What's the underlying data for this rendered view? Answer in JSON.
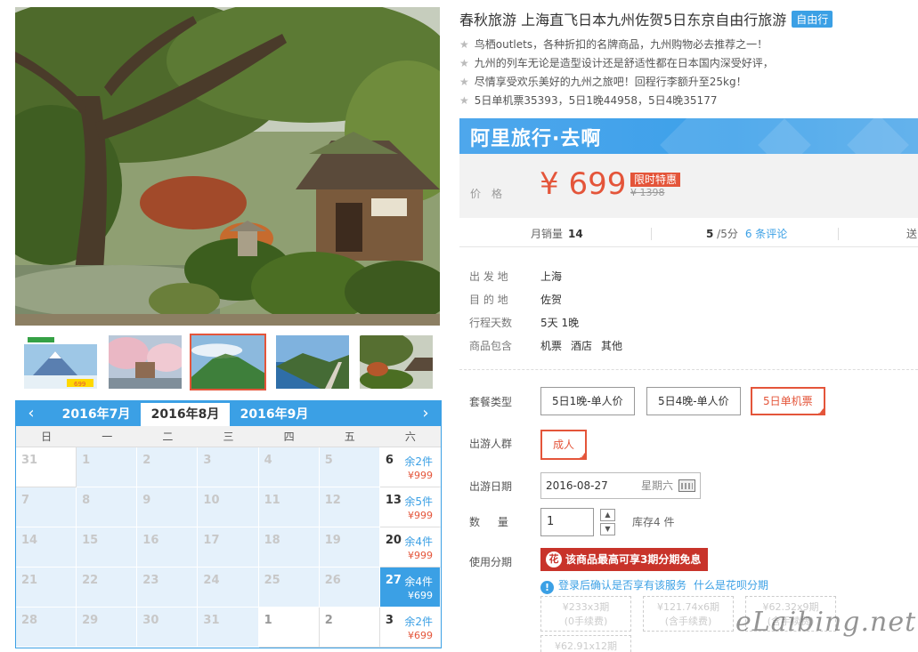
{
  "product": {
    "title": "春秋旅游 上海直飞日本九州佐贺5日东京自由行旅游",
    "tag": "自由行",
    "features": [
      "鸟栖outlets，各种折扣的名牌商品，九州购物必去推荐之一！",
      "九州的列车无论是造型设计还是舒适性都在日本国内深受好评，",
      "尽情享受欢乐美好的九州之旅吧！回程行李额升至25kg！",
      "5日单机票35393，5日1晚44958，5日4晚35177"
    ]
  },
  "price": {
    "brand": "阿里旅行·去啊",
    "label": "价格",
    "value": "¥ 699",
    "tag": "限时特惠",
    "original": "¥ 1398"
  },
  "stats": {
    "sales_label": "月销量",
    "sales_value": "14",
    "rating_value": "5",
    "rating_suffix": " /5分",
    "reviews": "6 条评论",
    "more": "送"
  },
  "info": [
    {
      "key": "出 发 地",
      "value": "上海"
    },
    {
      "key": "目 的 地",
      "value": "佐贺"
    },
    {
      "key": "行程天数",
      "value": "5天 1晚"
    },
    {
      "key": "商品包含",
      "items": [
        "机票",
        "酒店",
        "其他"
      ]
    }
  ],
  "options": {
    "package_label": "套餐类型",
    "packages": [
      "5日1晚-单人价",
      "5日4晚-单人价",
      "5日单机票"
    ],
    "package_selected": 2,
    "group_label": "出游人群",
    "groups": [
      "成人"
    ],
    "date_label": "出游日期",
    "date_value": "2016-08-27",
    "date_weekday": "星期六",
    "qty_label": "数 量",
    "qty_value": "1",
    "stock": "库存4 件",
    "installment_label": "使用分期"
  },
  "huabei": {
    "button": "该商品最高可享3期分期免息",
    "icon_glyph": "花",
    "note": "登录后确认是否享有该服务",
    "link": "什么是花呗分期",
    "plans": [
      {
        "amount": "¥233x3期",
        "fee": "(0手续费)"
      },
      {
        "amount": "¥121.74x6期",
        "fee": "(含手续费)"
      },
      {
        "amount": "¥62.32x9期",
        "fee": "(含手续费)"
      },
      {
        "amount": "¥62.91x12期",
        "fee": ""
      }
    ]
  },
  "calendar": {
    "prev": "‹",
    "next": "›",
    "months": [
      "2016年7月",
      "2016年8月",
      "2016年9月"
    ],
    "current_month_index": 1,
    "weekdays": [
      "日",
      "一",
      "二",
      "三",
      "四",
      "五",
      "六"
    ],
    "rows": [
      [
        {
          "d": "31",
          "t": "white"
        },
        {
          "d": "1"
        },
        {
          "d": "2"
        },
        {
          "d": "3"
        },
        {
          "d": "4"
        },
        {
          "d": "5"
        },
        {
          "d": "6",
          "t": "avail",
          "stock": "余2件",
          "price": "¥999"
        }
      ],
      [
        {
          "d": "7"
        },
        {
          "d": "8"
        },
        {
          "d": "9"
        },
        {
          "d": "10"
        },
        {
          "d": "11"
        },
        {
          "d": "12"
        },
        {
          "d": "13",
          "t": "avail",
          "stock": "余5件",
          "price": "¥999"
        }
      ],
      [
        {
          "d": "14"
        },
        {
          "d": "15"
        },
        {
          "d": "16"
        },
        {
          "d": "17"
        },
        {
          "d": "18"
        },
        {
          "d": "19"
        },
        {
          "d": "20",
          "t": "avail",
          "stock": "余4件",
          "price": "¥999"
        }
      ],
      [
        {
          "d": "21"
        },
        {
          "d": "22"
        },
        {
          "d": "23"
        },
        {
          "d": "24"
        },
        {
          "d": "25"
        },
        {
          "d": "26"
        },
        {
          "d": "27",
          "t": "sel",
          "stock": "余4件",
          "price": "¥699"
        }
      ],
      [
        {
          "d": "28"
        },
        {
          "d": "29"
        },
        {
          "d": "30"
        },
        {
          "d": "31"
        },
        {
          "d": "1",
          "t": "white next"
        },
        {
          "d": "2",
          "t": "white next"
        },
        {
          "d": "3",
          "t": "avail",
          "stock": "余2件",
          "price": "¥699"
        }
      ]
    ]
  },
  "thumb_badges": {
    "t0_price": "699"
  },
  "watermark": "eLaibing.net",
  "colors": {
    "accent": "#3ba0e5",
    "price": "#e4553a",
    "huabei": "#c8332a"
  }
}
